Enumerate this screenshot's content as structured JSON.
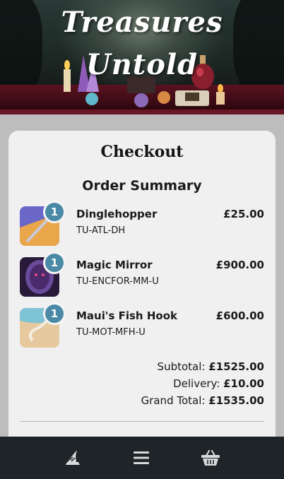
{
  "hero": {
    "title_line1": "Treasures",
    "title_line2": "Untold"
  },
  "checkout": {
    "title": "Checkout",
    "summary_title": "Order Summary",
    "items": [
      {
        "name": "Dinglehopper",
        "sku": "TU-ATL-DH",
        "price": "£25.00",
        "quantity": "1"
      },
      {
        "name": "Magic Mirror",
        "sku": "TU-ENCFOR-MM-U",
        "price": "£900.00",
        "quantity": "1"
      },
      {
        "name": "Maui's Fish Hook",
        "sku": "TU-MOT-MFH-U",
        "price": "£600.00",
        "quantity": "1"
      }
    ],
    "totals": {
      "subtotal_label": "Subtotal:",
      "subtotal_value": "£1525.00",
      "delivery_label": "Delivery:",
      "delivery_value": "£10.00",
      "grand_total_label": "Grand Total:",
      "grand_total_value": "£1535.00"
    }
  },
  "nav": {
    "icons": [
      "wizard-hat-icon",
      "menu-icon",
      "basket-icon"
    ]
  },
  "colors": {
    "badge": "#4a8aa6",
    "nav_bg": "#1e2428",
    "card_bg": "#f0f0f0",
    "page_bg": "#bdbdbd"
  }
}
